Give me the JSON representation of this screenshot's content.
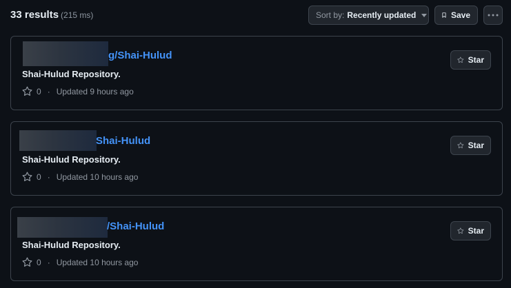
{
  "header": {
    "results_count": "33 results",
    "results_time": "(215 ms)",
    "sort_prefix": "Sort by:",
    "sort_value": "Recently updated",
    "save_label": "Save"
  },
  "results": [
    {
      "repo_suffix": "g/Shai-Hulud",
      "description": "Shai-Hulud Repository.",
      "stars": "0",
      "updated": "Updated 9 hours ago",
      "star_label": "Star"
    },
    {
      "repo_suffix": "Shai-Hulud",
      "description": "Shai-Hulud Repository.",
      "stars": "0",
      "updated": "Updated 10 hours ago",
      "star_label": "Star"
    },
    {
      "repo_suffix": "/Shai-Hulud",
      "description": "Shai-Hulud Repository.",
      "stars": "0",
      "updated": "Updated 10 hours ago",
      "star_label": "Star"
    }
  ],
  "colors": {
    "background": "#0d1117",
    "link": "#4493f8",
    "muted": "#9198a1",
    "border": "#3d444d"
  },
  "icons": [
    "star-icon",
    "bookmark-icon",
    "kebab-icon",
    "caret-down-icon"
  ]
}
